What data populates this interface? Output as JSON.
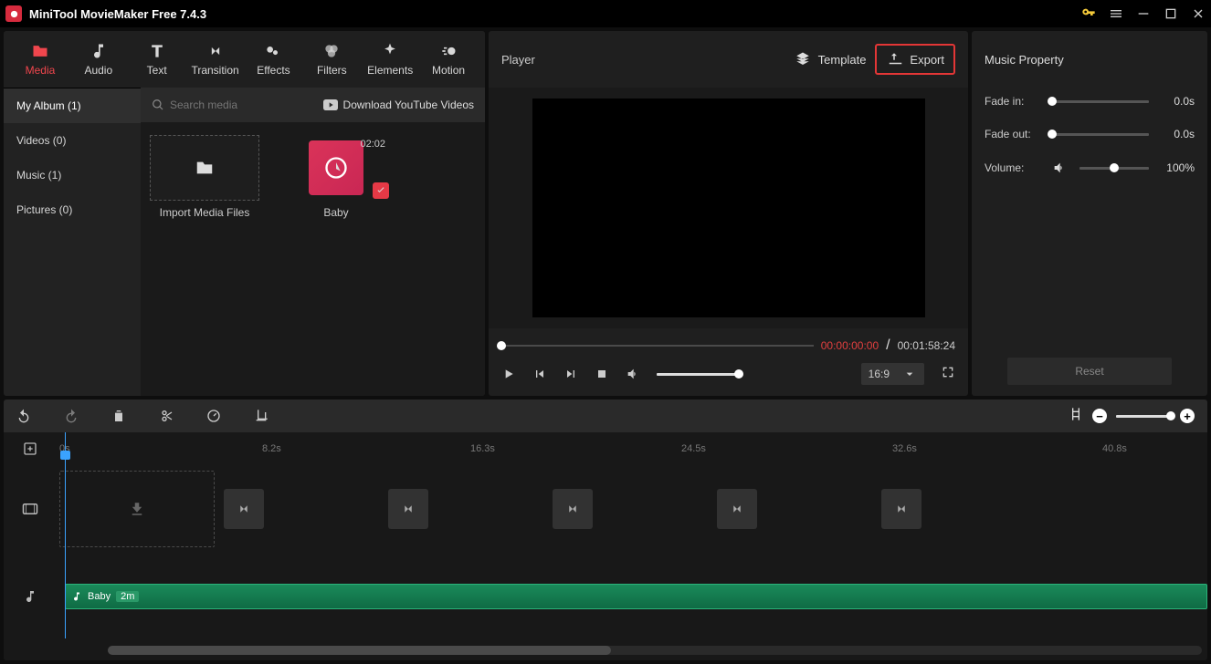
{
  "app": {
    "title": "MiniTool MovieMaker Free 7.4.3"
  },
  "tabs": {
    "media": "Media",
    "audio": "Audio",
    "text": "Text",
    "transition": "Transition",
    "effects": "Effects",
    "filters": "Filters",
    "elements": "Elements",
    "motion": "Motion"
  },
  "sidebar": {
    "my_album": "My Album (1)",
    "videos": "Videos (0)",
    "music": "Music (1)",
    "pictures": "Pictures (0)"
  },
  "media": {
    "search_placeholder": "Search media",
    "download_yt": "Download YouTube Videos",
    "import_label": "Import Media Files",
    "clip1": {
      "name": "Baby",
      "duration": "02:02"
    }
  },
  "player": {
    "title": "Player",
    "template_btn": "Template",
    "export_btn": "Export",
    "current_time": "00:00:00:00",
    "total_time": "00:01:58:24",
    "separator": " / ",
    "aspect": "16:9"
  },
  "property": {
    "title": "Music Property",
    "fade_in_label": "Fade in:",
    "fade_in_val": "0.0s",
    "fade_out_label": "Fade out:",
    "fade_out_val": "0.0s",
    "volume_label": "Volume:",
    "volume_val": "100%",
    "reset": "Reset"
  },
  "timeline": {
    "ticks": [
      "0s",
      "8.2s",
      "16.3s",
      "24.5s",
      "32.6s",
      "40.8s"
    ],
    "audio_clip_name": "Baby",
    "audio_clip_dur": "2m"
  }
}
